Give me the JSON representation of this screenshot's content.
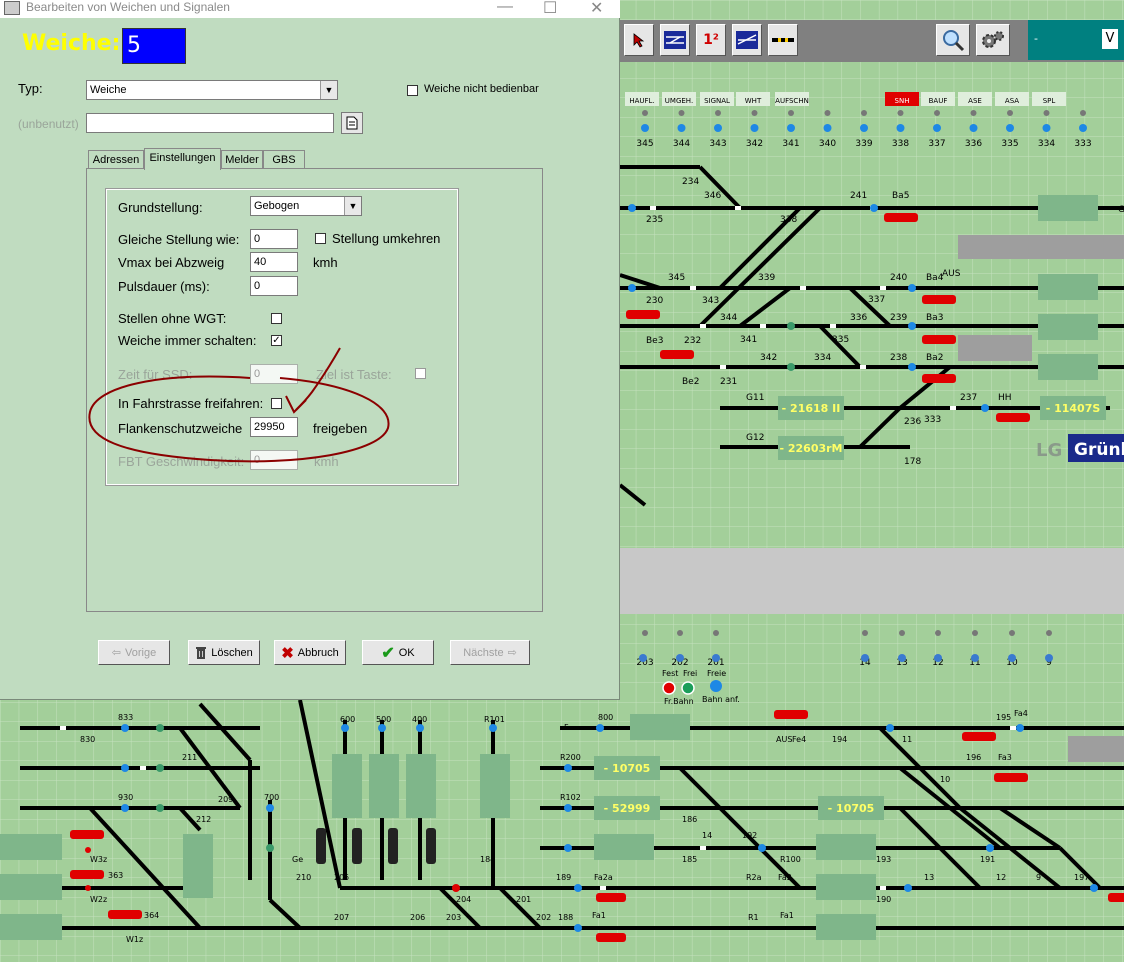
{
  "dialog": {
    "title": "Bearbeiten von Weichen und Signalen",
    "header_label": "Weiche:",
    "header_number": "5",
    "typ_label": "Typ:",
    "typ_value": "Weiche",
    "not_operable_label": "Weiche nicht bedienbar",
    "unused_label": "(unbenutzt)",
    "unused_value": "",
    "tabs": [
      "Adressen",
      "Einstellungen",
      "Melder",
      "GBS"
    ],
    "active_tab": "Einstellungen",
    "settings": {
      "grundstellung_label": "Grundstellung:",
      "grundstellung_value": "Gebogen",
      "gleiche_label": "Gleiche Stellung wie:",
      "gleiche_value": "0",
      "umkehren_label": "Stellung umkehren",
      "vmax_label": "Vmax bei Abzweig",
      "vmax_value": "40",
      "vmax_unit": "kmh",
      "puls_label": "Pulsdauer (ms):",
      "puls_value": "0",
      "ohne_wgt_label": "Stellen ohne WGT:",
      "immer_label": "Weiche immer schalten:",
      "immer_checked": "✓",
      "zeit_label": "Zeit für SSD:",
      "zeit_value": "0",
      "ziel_label": "Ziel ist Taste:",
      "fahrstrasse_label": "In Fahrstrasse freifahren:",
      "flanken_label": "Flankenschutzweiche",
      "flanken_value": "29950",
      "flanken_suffix": "freigeben",
      "fbt_label": "FBT Geschwindigkeit:",
      "fbt_value": "0",
      "fbt_unit": "kmh"
    },
    "buttons": {
      "prev": "Vorige",
      "delete": "Löschen",
      "cancel": "Abbruch",
      "ok": "OK",
      "next": "Nächste"
    }
  },
  "toolbar": {
    "icons": [
      "cursor-icon",
      "track-edit-icon",
      "number-icon",
      "signal-edit-icon",
      "line-icon",
      "zoom-icon",
      "settings-icon"
    ],
    "num_glyph": "1²",
    "dropdown_value": "V",
    "dropdown_prefix": "-"
  },
  "track": {
    "colors": {
      "bg": "#a3cf9a",
      "grid": "#c5e2bf",
      "track": "#000000",
      "train": "#7fb68a",
      "train_text": "#ffff66",
      "point": "#1e88e5",
      "red": "#e00000"
    },
    "top_labels": [
      "HAUFL.",
      "UMGEH.",
      "SIGNAL",
      "WHT",
      "AUFSCHN",
      "SNH",
      "BAUF",
      "ASE",
      "ASA",
      "SPL"
    ],
    "top_numbers": [
      "345",
      "344",
      "343",
      "342",
      "341",
      "340",
      "339",
      "338",
      "337",
      "336",
      "335",
      "334",
      "333"
    ],
    "track_labels": [
      "234",
      "346",
      "235",
      "338",
      "241",
      "Ba5",
      "G",
      "230",
      "345",
      "343",
      "339",
      "344",
      "337",
      "240",
      "Ba4",
      "AUS",
      "Be3",
      "232",
      "341",
      "336",
      "335",
      "239",
      "Ba3",
      "342",
      "334",
      "238",
      "Ba2",
      "Be2",
      "231",
      "G11",
      "G12",
      "236",
      "237",
      "333",
      "HH",
      "178"
    ],
    "trains": [
      "- 21618 II",
      "- 11407S",
      "- 22603rM",
      "- 10705",
      "- 52999",
      "- 10705"
    ],
    "lg_label": "LG",
    "station": "Grünb",
    "bottom_numbers": [
      "203",
      "202",
      "201",
      "14",
      "13",
      "12",
      "11",
      "10",
      "9"
    ],
    "bottom_labels": [
      "Fest",
      "Frei",
      "Freie",
      "Fr.Bahn",
      "Bahn anf.",
      "833",
      "830",
      "930",
      "211",
      "209",
      "212",
      "W3z",
      "363",
      "W2z",
      "364",
      "W1z",
      "600",
      "500",
      "400",
      "R101",
      "R200",
      "R102",
      "700",
      "800",
      "F",
      "210",
      "205",
      "207",
      "206",
      "203",
      "204",
      "201",
      "202",
      "184",
      "189",
      "188",
      "Fa2a",
      "Fa1",
      "R2a",
      "R1",
      "Fa2",
      "Fa1",
      "R100",
      "186",
      "185",
      "192",
      "193",
      "190",
      "191",
      "196",
      "195",
      "Fa4",
      "Fa3",
      "194",
      "Fe4",
      "AUS",
      "11",
      "13",
      "12",
      "9",
      "197",
      "10",
      "14",
      "Ge"
    ]
  }
}
